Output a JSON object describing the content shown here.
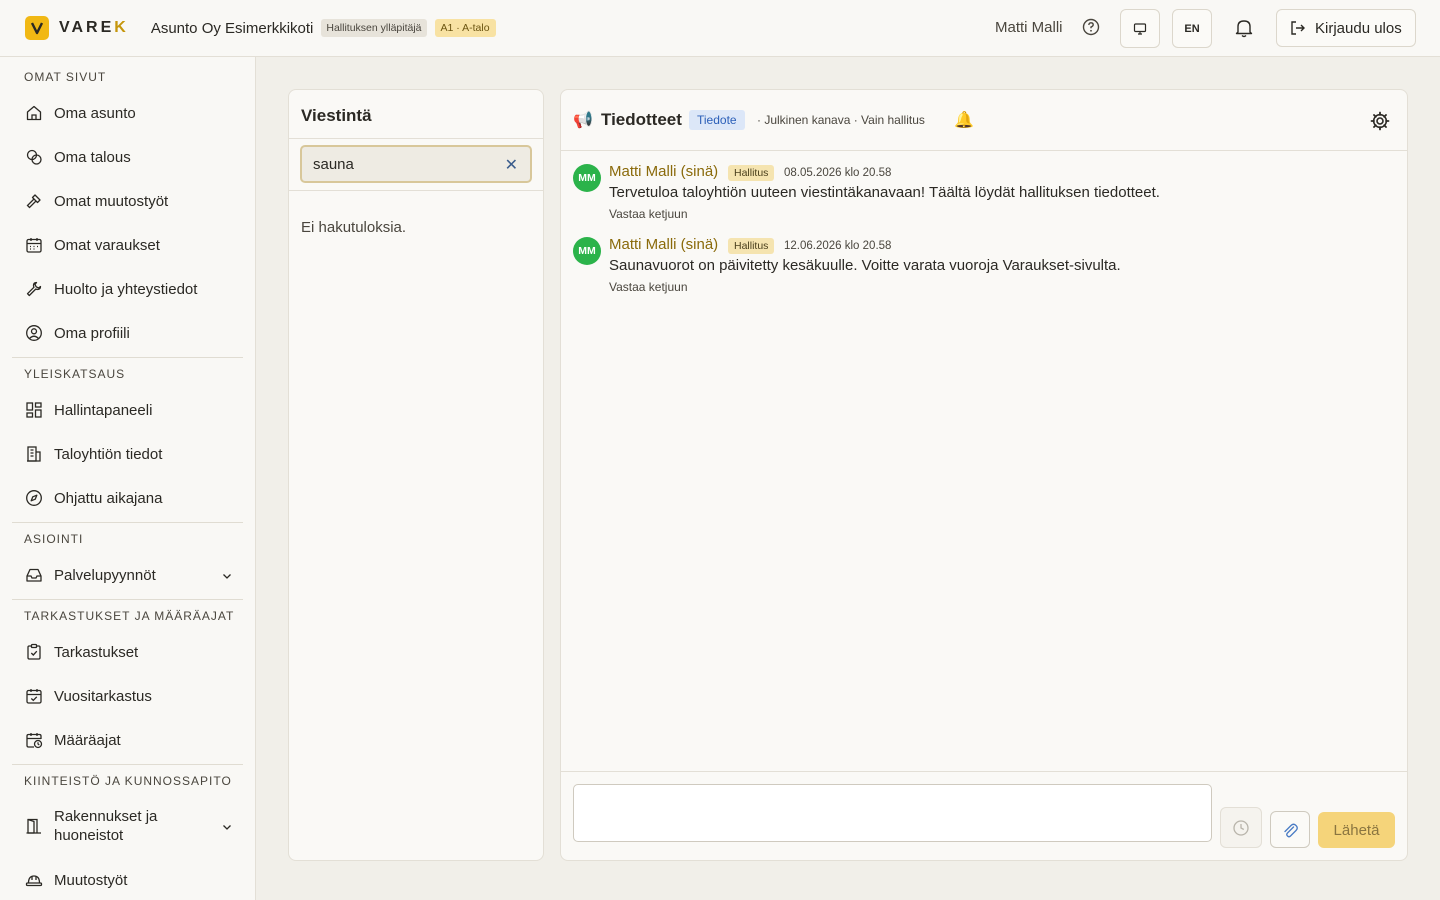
{
  "header": {
    "brand": "VARE",
    "brand_accent": "K",
    "org_name": "Asunto Oy Esimerkkikoti",
    "role_badge": "Hallituksen ylläpitäjä",
    "apartment_badge": "A1 · A-talo",
    "user_name": "Matti Malli",
    "language": "EN",
    "logout_label": "Kirjaudu ulos"
  },
  "sidebar": {
    "sections": [
      {
        "title": "OMAT SIVUT",
        "items": [
          {
            "label": "Oma asunto",
            "icon": "home-icon"
          },
          {
            "label": "Oma talous",
            "icon": "coins-icon"
          },
          {
            "label": "Omat muutostyöt",
            "icon": "hammer-icon"
          },
          {
            "label": "Omat varaukset",
            "icon": "calendar-icon"
          },
          {
            "label": "Huolto ja yhteystiedot",
            "icon": "wrench-icon"
          },
          {
            "label": "Oma profiili",
            "icon": "user-circle-icon"
          }
        ]
      },
      {
        "title": "YLEISKATSAUS",
        "items": [
          {
            "label": "Hallintapaneeli",
            "icon": "dashboard-icon"
          },
          {
            "label": "Taloyhtiön tiedot",
            "icon": "building-icon"
          },
          {
            "label": "Ohjattu aikajana",
            "icon": "compass-icon"
          }
        ]
      },
      {
        "title": "ASIOINTI",
        "items": [
          {
            "label": "Palvelupyynnöt",
            "icon": "inbox-icon"
          }
        ]
      },
      {
        "title": "TARKASTUKSET JA MÄÄRÄAJAT",
        "items": [
          {
            "label": "Tarkastukset",
            "icon": "clipboard-check-icon"
          },
          {
            "label": "Vuositarkastus",
            "icon": "calendar-check-icon"
          },
          {
            "label": "Määräajat",
            "icon": "calendar-clock-icon"
          }
        ]
      },
      {
        "title": "KIINTEISTÖ JA KUNNOSSAPITO",
        "items": [
          {
            "label": "Rakennukset ja huoneistot",
            "icon": "door-icon"
          },
          {
            "label": "Muutostyöt",
            "icon": "hardhat-icon"
          }
        ]
      }
    ]
  },
  "channels": {
    "title": "Viestintä",
    "search_value": "sauna",
    "empty_text": "Ei hakutuloksia."
  },
  "chat": {
    "channel_name": "Tiedotteet",
    "channel_tag": "Tiedote",
    "channel_meta": "· Julkinen kanava · Vain hallitus",
    "messages": [
      {
        "initials": "MM",
        "author": "Matti Malli (sinä)",
        "role": "Hallitus",
        "timestamp": "08.05.2026 klo 20.58",
        "body": "Tervetuloa taloyhtiön uuteen viestintäkanavaan! Täältä löydät hallituksen tiedotteet.",
        "reply": "Vastaa ketjuun"
      },
      {
        "initials": "MM",
        "author": "Matti Malli (sinä)",
        "role": "Hallitus",
        "timestamp": "12.06.2026 klo 20.58",
        "body": "Saunavuorot on päivitetty kesäkuulle. Voitte varata vuoroja Varaukset-sivulta.",
        "reply": "Vastaa ketjuun"
      }
    ],
    "composer_value": "",
    "send_label": "Lähetä"
  },
  "colors": {
    "brand": "#f1b814",
    "avatar": "#2bb34a",
    "send_disabled": "#f5d47a",
    "tag_blue": "#2b5fb8"
  }
}
